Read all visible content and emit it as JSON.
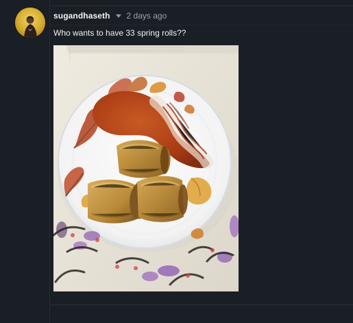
{
  "comment": {
    "author": "sugandhaseth",
    "time": "2 days ago",
    "text": "Who wants to have 33 spring rolls??",
    "avatar_icon": "profile-photo",
    "menu_icon": "chevron-down-icon",
    "image_alt": "Spring rolls with sauce on a plate"
  },
  "colors": {
    "background": "#1a1f26",
    "text": "#f2f2f2",
    "muted_text": "#9ba2ab"
  }
}
